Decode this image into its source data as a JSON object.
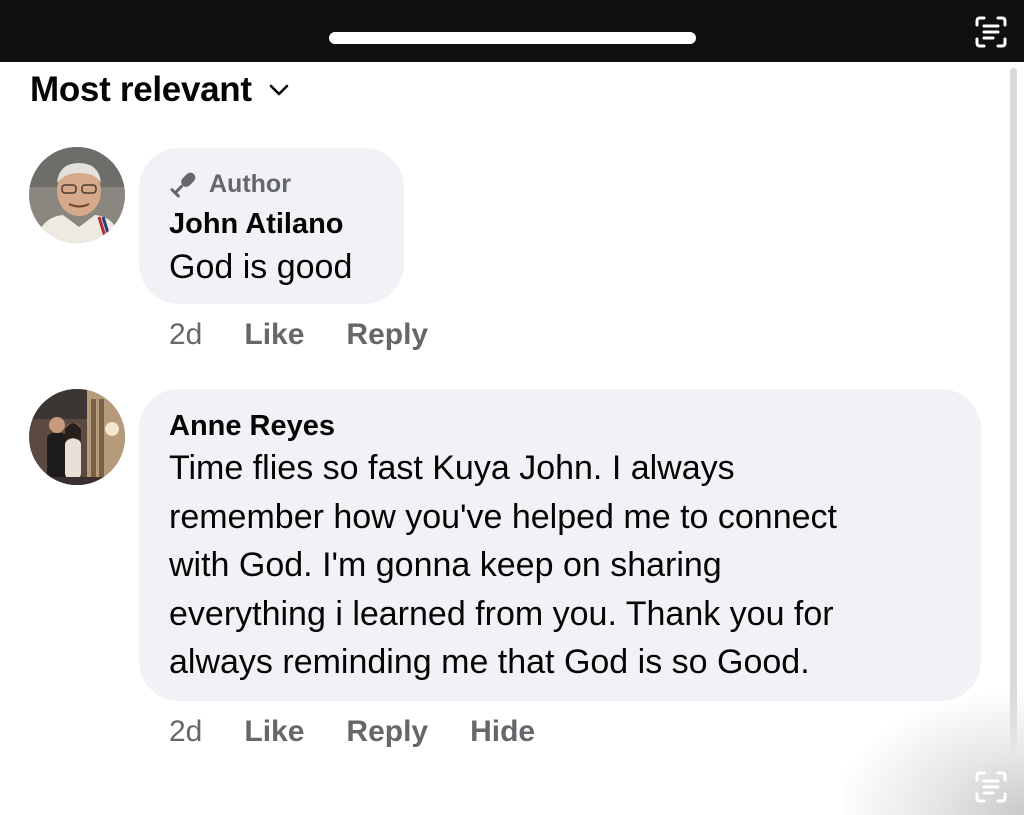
{
  "header": {
    "sort_label": "Most relevant",
    "scan_icon": "scan-text-icon"
  },
  "comments": [
    {
      "badge": "Author",
      "badge_icon": "microphone-icon",
      "name": "John Atilano",
      "text": "God is good",
      "time": "2d",
      "actions": [
        "Like",
        "Reply"
      ]
    },
    {
      "name": "Anne Reyes",
      "text_lines": [
        "Time flies so fast Kuya John.  I always",
        "remember how you've  helped me to connect",
        "with God.  I'm  gonna keep on sharing",
        "everything i learned from you. Thank you for",
        "always reminding me that God is so Good."
      ],
      "time": "2d",
      "actions": [
        "Like",
        "Reply",
        "Hide"
      ]
    }
  ],
  "colors": {
    "top_bar": "#0e1011",
    "bubble": "#f0f2f5",
    "primary_text": "#050505",
    "secondary_text": "#65676b"
  }
}
